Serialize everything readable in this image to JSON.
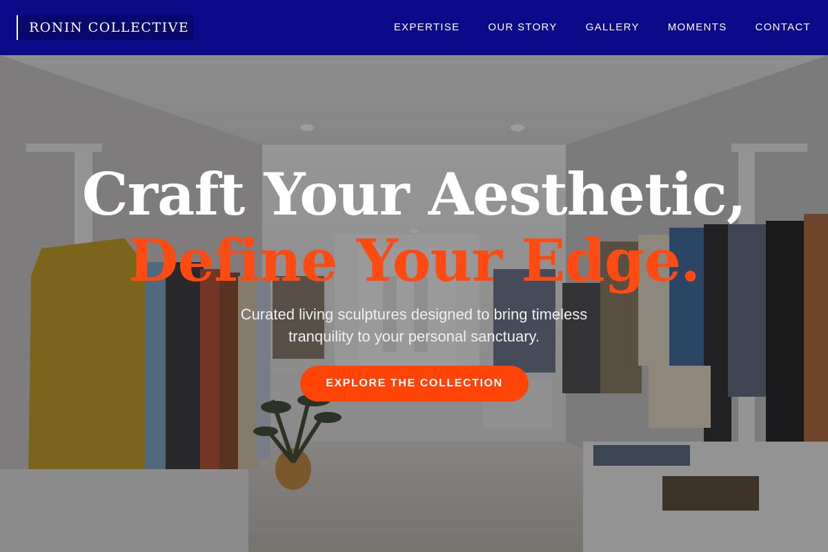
{
  "brand": {
    "name": "RONIN COLLECTIVE"
  },
  "nav": {
    "items": [
      {
        "label": "EXPERTISE"
      },
      {
        "label": "OUR STORY"
      },
      {
        "label": "GALLERY"
      },
      {
        "label": "MOMENTS"
      },
      {
        "label": "CONTACT"
      }
    ]
  },
  "hero": {
    "headline_line1": "Craft Your Aesthetic,",
    "headline_line2": "Define Your Edge.",
    "subtitle": "Curated living sculptures designed to bring timeless tranquility to your personal sanctuary.",
    "cta_label": "EXPLORE THE COLLECTION"
  },
  "colors": {
    "nav_background": "#0b0b8a",
    "accent": "#ff4407",
    "headline": "#ffffff"
  }
}
